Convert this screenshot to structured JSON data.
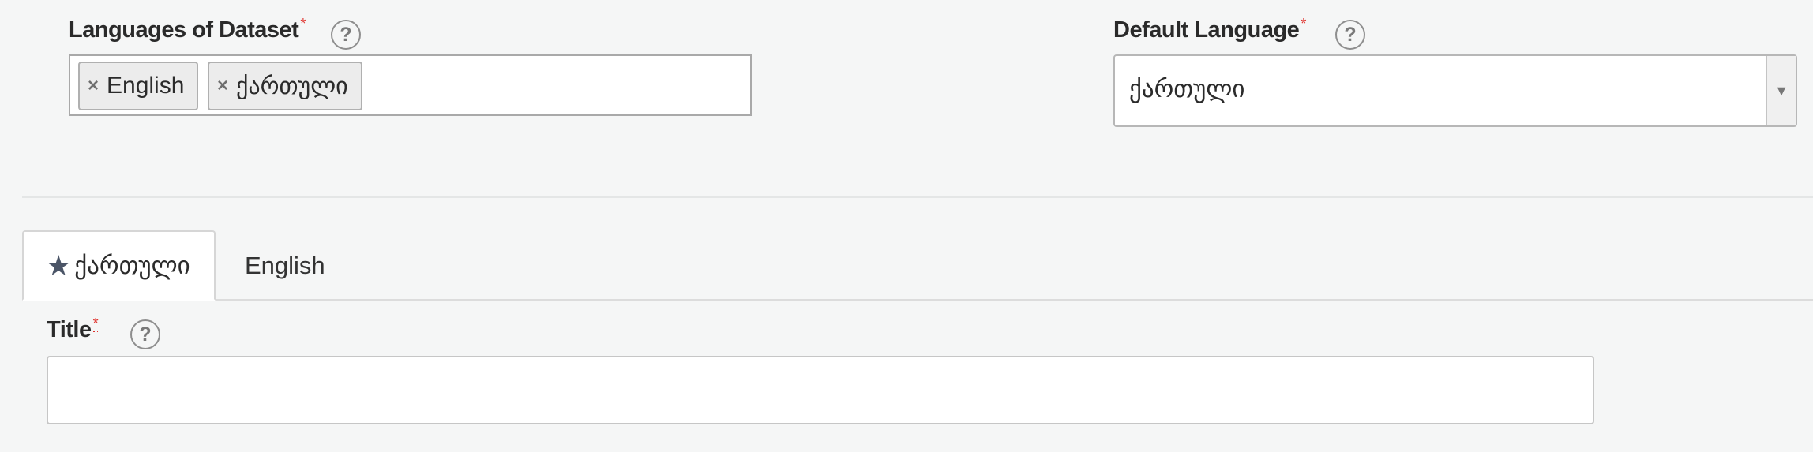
{
  "languages_field": {
    "label": "Languages of Dataset",
    "required_mark": "*",
    "help": "?",
    "tags": [
      {
        "remove": "×",
        "label": "English"
      },
      {
        "remove": "×",
        "label": "ქართული"
      }
    ]
  },
  "default_language_field": {
    "label": "Default Language",
    "required_mark": "*",
    "help": "?",
    "selected_value": "ქართული",
    "arrow": "▼"
  },
  "tabs": [
    {
      "icon": "★",
      "label": "ქართული",
      "active": true
    },
    {
      "label": "English",
      "active": false
    }
  ],
  "title_field": {
    "label": "Title",
    "required_mark": "*",
    "help": "?",
    "value": ""
  },
  "colors": {
    "background": "#f5f6f6",
    "required": "#e0342f",
    "star": "#4b5567"
  }
}
